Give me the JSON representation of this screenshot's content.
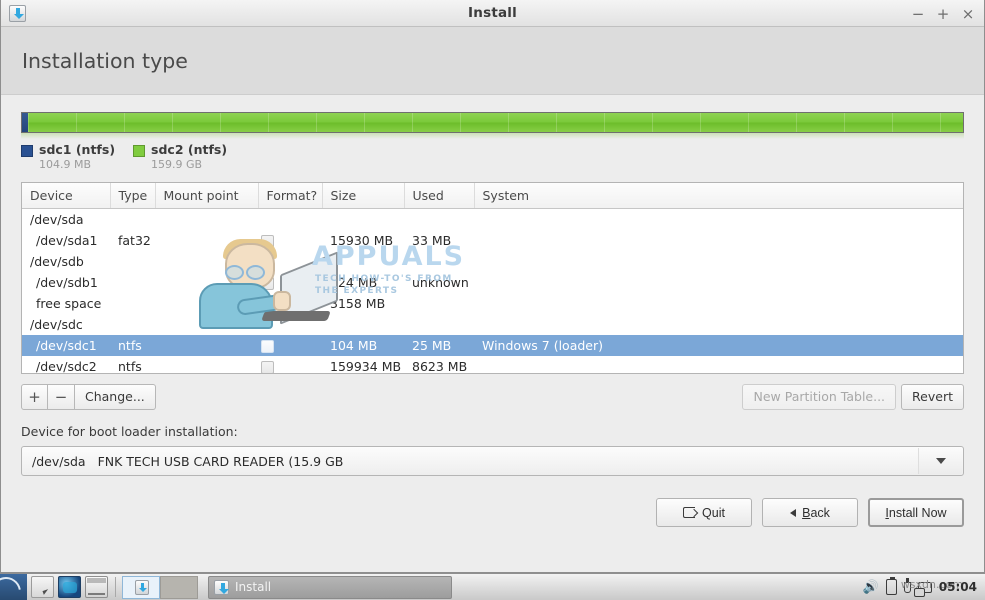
{
  "window": {
    "title": "Install",
    "icon": "installer-icon",
    "controls": {
      "minimize": "−",
      "maximize": "+",
      "close": "×"
    }
  },
  "header": {
    "page_title": "Installation type"
  },
  "partition_bar": {
    "segments": [
      {
        "name": "sdc1",
        "fs": "ntfs",
        "color": "#2a5192",
        "percent": 0.6
      },
      {
        "name": "sdc2",
        "fs": "ntfs",
        "color": "#80cc3f",
        "percent": 99.4
      }
    ],
    "legend": [
      {
        "label": "sdc1 (ntfs)",
        "size": "104.9 MB",
        "color": "#2a5192"
      },
      {
        "label": "sdc2 (ntfs)",
        "size": "159.9 GB",
        "color": "#80cc3f"
      }
    ]
  },
  "table": {
    "columns": [
      "Device",
      "Type",
      "Mount point",
      "Format?",
      "Size",
      "Used",
      "System"
    ],
    "rows": [
      {
        "device": "/dev/sda",
        "type": "",
        "mount": "",
        "format": false,
        "size": "",
        "used": "",
        "system": "",
        "indent": false,
        "selected": false,
        "checkbox": false
      },
      {
        "device": "/dev/sda1",
        "type": "fat32",
        "mount": "",
        "format": false,
        "size": "15930 MB",
        "used": "33 MB",
        "system": "",
        "indent": true,
        "selected": false,
        "checkbox": true
      },
      {
        "device": "/dev/sdb",
        "type": "",
        "mount": "",
        "format": false,
        "size": "",
        "used": "",
        "system": "",
        "indent": false,
        "selected": false,
        "checkbox": false
      },
      {
        "device": "/dev/sdb1",
        "type": "",
        "mount": "",
        "format": false,
        "size": "924 MB",
        "used": "unknown",
        "system": "",
        "indent": true,
        "selected": false,
        "checkbox": true
      },
      {
        "device": "free space",
        "type": "",
        "mount": "",
        "format": false,
        "size": "3158 MB",
        "used": "",
        "system": "",
        "indent": true,
        "selected": false,
        "checkbox": true
      },
      {
        "device": "/dev/sdc",
        "type": "",
        "mount": "",
        "format": false,
        "size": "",
        "used": "",
        "system": "",
        "indent": false,
        "selected": false,
        "checkbox": false
      },
      {
        "device": "/dev/sdc1",
        "type": "ntfs",
        "mount": "",
        "format": false,
        "size": "104 MB",
        "used": "25 MB",
        "system": "Windows 7 (loader)",
        "indent": true,
        "selected": true,
        "checkbox": true
      },
      {
        "device": "/dev/sdc2",
        "type": "ntfs",
        "mount": "",
        "format": false,
        "size": "159934 MB",
        "used": "8623 MB",
        "system": "",
        "indent": true,
        "selected": false,
        "checkbox": true
      }
    ]
  },
  "tools": {
    "add_label": "+",
    "remove_label": "−",
    "change_label": "Change...",
    "new_partition_table_label": "New Partition Table...",
    "revert_label": "Revert"
  },
  "bootloader": {
    "label": "Device for boot loader installation:",
    "selected_device": "/dev/sda",
    "selected_description": "FNK TECH USB CARD READER (15.9 GB"
  },
  "footer": {
    "quit_label": "Quit",
    "back_label_prefix": "",
    "back_label_accel": "B",
    "back_label_rest": "ack",
    "install_accel": "I",
    "install_rest": "nstall Now"
  },
  "watermark": {
    "brand": "APPUALS",
    "tagline_line1": "TECH HOW-TO'S FROM",
    "tagline_line2": "THE EXPERTS"
  },
  "taskbar": {
    "start_label": "start-menu",
    "launcher_icons": [
      "file-manager-icon",
      "browser-icon",
      "terminal-icon"
    ],
    "workspaces": [
      "workspace-1",
      "workspace-2"
    ],
    "task_label": "Install",
    "tray": {
      "volume": "🔊",
      "clock": "05:04",
      "watermark_text": "wsxdn.com"
    }
  }
}
